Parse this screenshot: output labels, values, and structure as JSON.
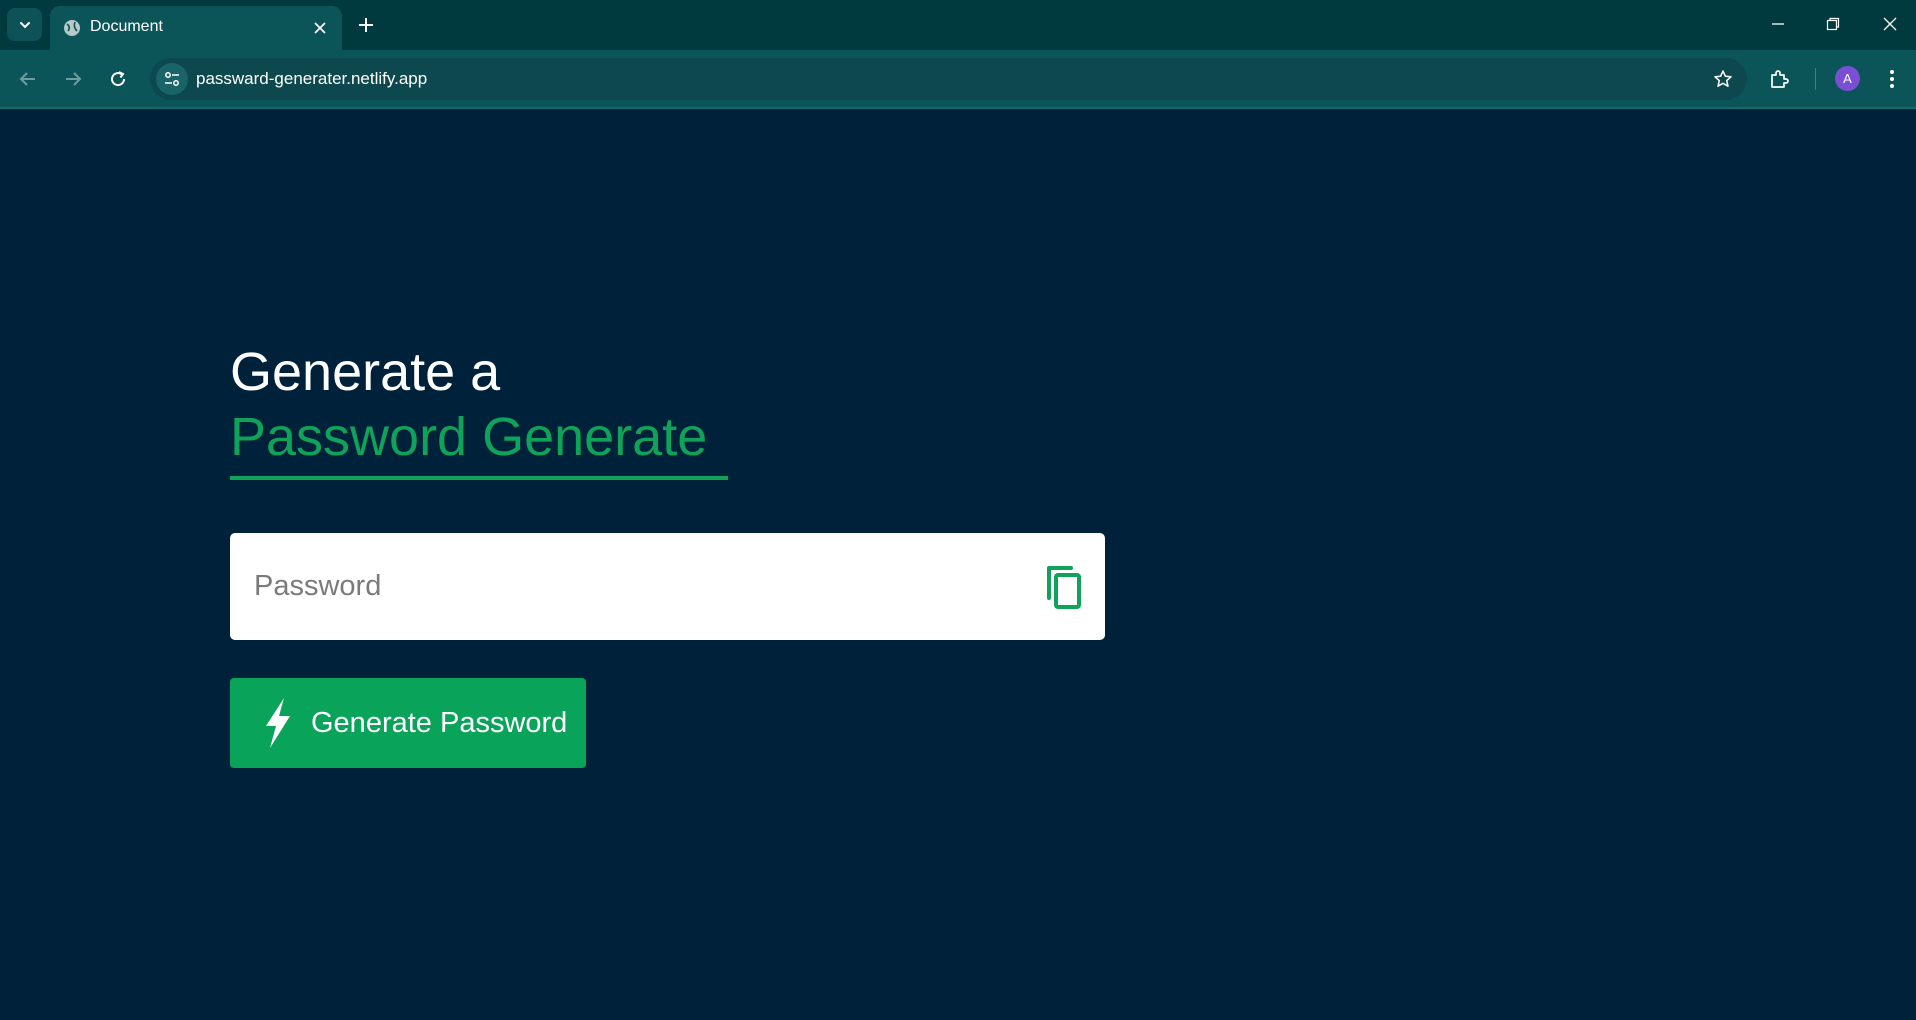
{
  "browser": {
    "tab": {
      "title": "Document"
    },
    "address_bar": {
      "url": "passward-generater.netlify.app"
    },
    "profile": {
      "initial": "A"
    }
  },
  "page": {
    "heading_line1": "Generate a",
    "heading_line2": "Password Generate",
    "password_field": {
      "placeholder": "Password",
      "value": ""
    },
    "generate_button": {
      "label": "Generate Password"
    }
  },
  "colors": {
    "background": "#00213a",
    "accent": "#0fa35a",
    "chrome": "#0b5559"
  }
}
